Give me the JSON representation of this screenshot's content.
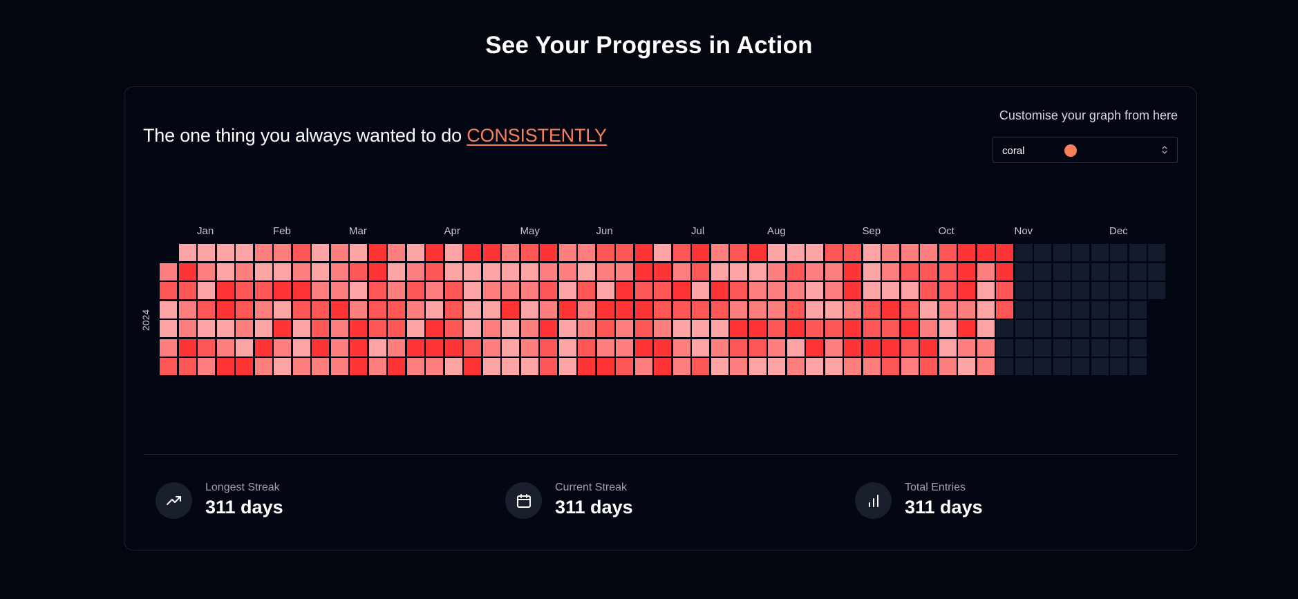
{
  "page": {
    "title": "See Your Progress in Action"
  },
  "card": {
    "headline_prefix": "The one thing you always wanted to do",
    "headline_accent": "CONSISTENTLY",
    "customise_label": "Customise your graph from here",
    "color_select": {
      "value": "coral",
      "swatch_color": "#fb7f5a"
    }
  },
  "colors": {
    "accent": "#fb7f5a",
    "empty_cell": "#141b2c",
    "level_1": "#ffa4a4",
    "level_2": "#ff7f7f",
    "level_3": "#ff5656",
    "level_4": "#ff3434"
  },
  "heatmap": {
    "year": "2024",
    "months": [
      "Jan",
      "Feb",
      "Mar",
      "Apr",
      "May",
      "Jun",
      "Jul",
      "Aug",
      "Sep",
      "Oct",
      "Nov",
      "Dec"
    ],
    "first_weekday_offset": 1,
    "total_days": 366,
    "filled_days": 311,
    "icons": {
      "select_chevron": "chevron-up-down-icon"
    }
  },
  "stats": [
    {
      "label": "Longest Streak",
      "value": "311 days",
      "icon": "trending-up-icon"
    },
    {
      "label": "Current Streak",
      "value": "311 days",
      "icon": "calendar-icon"
    },
    {
      "label": "Total Entries",
      "value": "311 days",
      "icon": "bar-chart-icon"
    }
  ]
}
